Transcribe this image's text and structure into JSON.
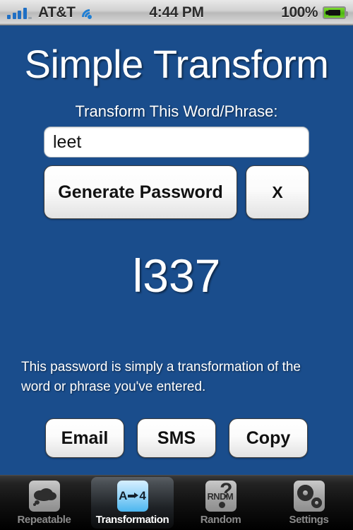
{
  "status_bar": {
    "signal_icon": "signal-bars-icon",
    "carrier": "AT&T",
    "wifi_icon": "wifi-icon",
    "time": "4:44 PM",
    "battery_percent": "100%",
    "battery_icon": "battery-charging-icon"
  },
  "app": {
    "title": "Simple Transform",
    "background_color": "#1a4d8c",
    "field_label": "Transform This Word/Phrase:",
    "input_value": "leet",
    "input_placeholder": "",
    "generate_label": "Generate Password",
    "clear_label": "X",
    "result": "l337",
    "description": "This password is simply a transformation of the word or phrase you've entered.",
    "actions": [
      {
        "label": "Email",
        "name": "email-button"
      },
      {
        "label": "SMS",
        "name": "sms-button"
      },
      {
        "label": "Copy",
        "name": "copy-button"
      }
    ]
  },
  "tabbar": {
    "items": [
      {
        "label": "Repeatable",
        "icon": "thought-cloud-icon",
        "active": false
      },
      {
        "label": "Transformation",
        "icon": "a-to-4-icon",
        "active": true
      },
      {
        "label": "Random",
        "icon": "rndm-question-icon",
        "active": false
      },
      {
        "label": "Settings",
        "icon": "gears-icon",
        "active": false
      }
    ]
  }
}
